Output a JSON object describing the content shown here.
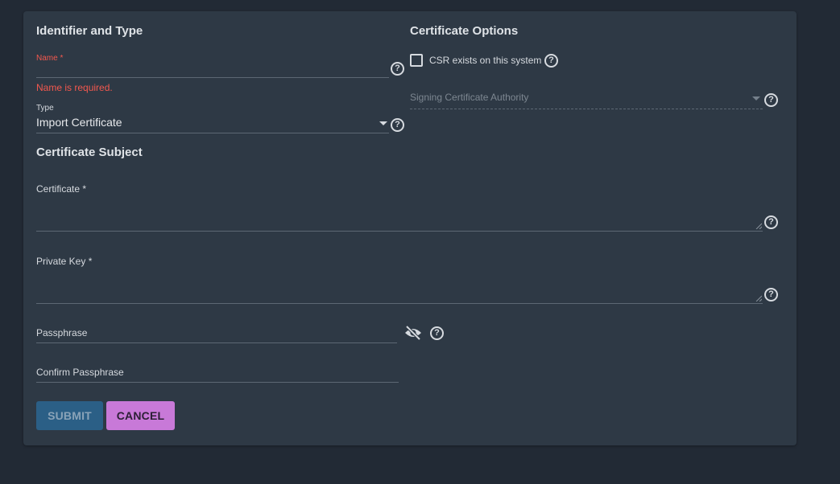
{
  "left_section": {
    "title": "Identifier and Type",
    "name_label": "Name *",
    "name_error": "Name is required.",
    "type_label": "Type",
    "type_value": "Import Certificate"
  },
  "right_section": {
    "title": "Certificate Options",
    "csr_label": "CSR exists on this system",
    "signing_ca_placeholder": "Signing Certificate Authority"
  },
  "subject_section": {
    "title": "Certificate Subject",
    "certificate_label": "Certificate *",
    "private_key_label": "Private Key *",
    "passphrase_label": "Passphrase",
    "confirm_passphrase_label": "Confirm Passphrase"
  },
  "actions": {
    "submit": "SUBMIT",
    "cancel": "CANCEL"
  },
  "icons": {
    "help": "help-circle-icon",
    "visibility": "eye-off-icon",
    "dropdown": "caret-down-icon"
  },
  "help_glyph": "?",
  "colors": {
    "background": "#222a35",
    "card": "#2e3945",
    "error": "#f3584e",
    "submit_bg": "#2b5f86",
    "cancel_bg": "#c879d8"
  }
}
